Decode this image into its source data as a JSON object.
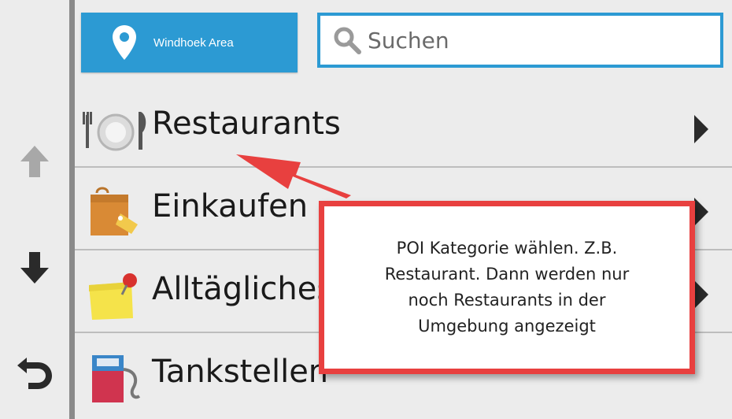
{
  "nav": {
    "up_icon": "arrow-up-icon",
    "down_icon": "arrow-down-icon",
    "back_icon": "back-icon"
  },
  "location": {
    "label": "Windhoek Area",
    "icon": "map-pin-icon"
  },
  "search": {
    "placeholder": "Suchen",
    "icon": "search-icon"
  },
  "categories": [
    {
      "label": "Restaurants",
      "icon": "restaurant-icon"
    },
    {
      "label": "Einkaufen",
      "icon": "shopping-bag-icon"
    },
    {
      "label": "Alltägliches",
      "icon": "sticky-note-icon"
    },
    {
      "label": "Tankstellen",
      "icon": "fuel-pump-icon"
    }
  ],
  "annotation": {
    "text_lines": [
      "POI Kategorie wählen. Z.B.",
      "Restaurant. Dann werden nur",
      "noch Restaurants in der",
      "Umgebung angezeigt"
    ]
  },
  "colors": {
    "accent": "#2c9ad3",
    "callout_border": "#e8403f",
    "background": "#ececec"
  }
}
